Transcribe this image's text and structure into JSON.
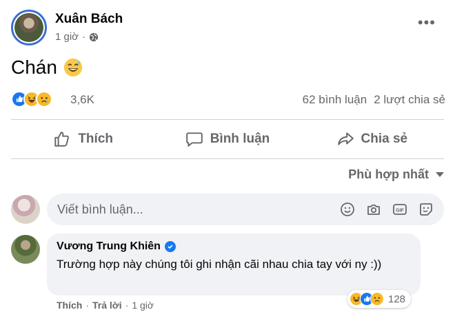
{
  "post": {
    "author": "Xuân Bách",
    "time": "1 giờ",
    "privacy_icon": "globe-icon",
    "text": "Chán",
    "emoji": "grinning-sweat-emoji"
  },
  "stats": {
    "reaction_icons": [
      "like-reaction-icon",
      "haha-reaction-icon",
      "sad-reaction-icon"
    ],
    "reaction_count": "3,6K",
    "comments": "62 bình luận",
    "shares": "2 lượt chia sẻ"
  },
  "actions": {
    "like": "Thích",
    "comment": "Bình luận",
    "share": "Chia sẻ"
  },
  "sort": {
    "label": "Phù hợp nhất"
  },
  "composer": {
    "placeholder": "Viết bình luận...",
    "icons": [
      "emoji-icon",
      "camera-icon",
      "gif-icon",
      "sticker-icon"
    ]
  },
  "comment": {
    "author": "Vương Trung Khiên",
    "verified": true,
    "text": "Trường hợp này chúng tôi ghi nhận cãi nhau chia tay với ny :))",
    "like": "Thích",
    "reply": "Trả lời",
    "time": "1 giờ",
    "reaction_count": "128"
  },
  "colors": {
    "primary_text": "#050505",
    "secondary_text": "#65676b",
    "bubble_bg": "#f0f2f5",
    "like_blue": "#1877f2",
    "haha_yellow": "#f7b928"
  }
}
